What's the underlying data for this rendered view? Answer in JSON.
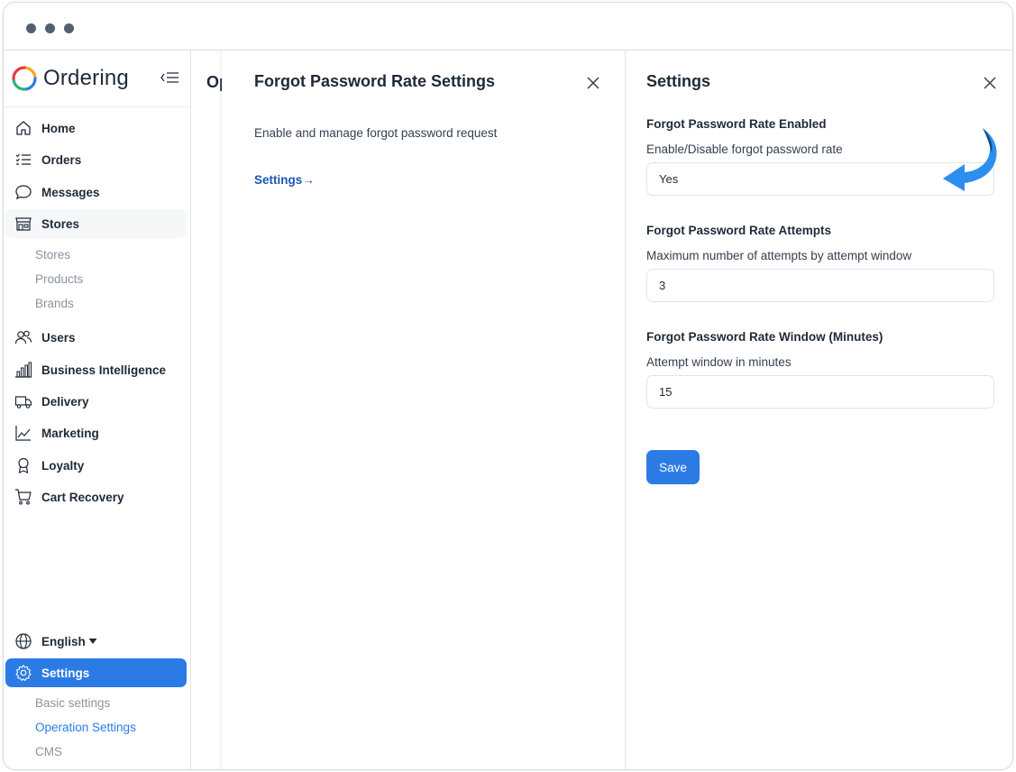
{
  "app": {
    "brand_name": "Ordering"
  },
  "sidebar": {
    "items": [
      {
        "label": "Home",
        "icon": "home-icon"
      },
      {
        "label": "Orders",
        "icon": "list-icon"
      },
      {
        "label": "Messages",
        "icon": "chat-icon"
      },
      {
        "label": "Stores",
        "icon": "store-icon"
      },
      {
        "label": "Users",
        "icon": "users-icon"
      },
      {
        "label": "Business Intelligence",
        "icon": "bar-chart-icon"
      },
      {
        "label": "Delivery",
        "icon": "truck-icon"
      },
      {
        "label": "Marketing",
        "icon": "line-chart-icon"
      },
      {
        "label": "Loyalty",
        "icon": "award-icon"
      },
      {
        "label": "Cart Recovery",
        "icon": "cart-icon"
      }
    ],
    "stores_sub": [
      "Stores",
      "Products",
      "Brands"
    ],
    "language": "English",
    "settings_label": "Settings",
    "settings_sub": [
      "Basic settings",
      "Operation Settings",
      "CMS"
    ]
  },
  "page": {
    "title_partial": "Op"
  },
  "drawer_mid": {
    "title": "Forgot Password Rate Settings",
    "description": "Enable and manage forgot password request",
    "link": "Settings→"
  },
  "drawer_right": {
    "title": "Settings",
    "fields": [
      {
        "title": "Forgot Password Rate Enabled",
        "description": "Enable/Disable forgot password rate",
        "value": "Yes"
      },
      {
        "title": "Forgot Password Rate Attempts",
        "description": "Maximum number of attempts by attempt window",
        "value": "3"
      },
      {
        "title": "Forgot Password Rate Window (Minutes)",
        "description": "Attempt window in minutes",
        "value": "15"
      }
    ],
    "save_label": "Save"
  },
  "colors": {
    "accent": "#2c7be5",
    "link": "#1a56b5",
    "text": "#1f2a37",
    "hint_arrow": "#2d8ef0"
  }
}
